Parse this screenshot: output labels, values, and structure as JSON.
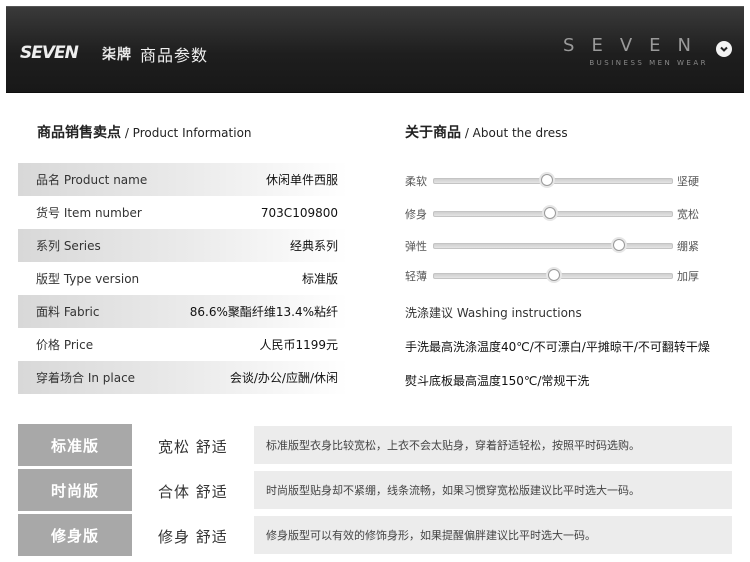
{
  "header": {
    "logo_text": "SEVEN",
    "logo_sub": "柒牌",
    "title": "商品参数",
    "brand_word": "SEVEN",
    "brand_tagline": "BUSINESS MEN WEAR",
    "icon": "chevron-down-icon"
  },
  "product_info": {
    "title_cn": "商品销售卖点",
    "title_en": "/ Product Information",
    "rows": [
      {
        "label": "品名 Product name",
        "value": "休闲单件西服"
      },
      {
        "label": "货号 Item number",
        "value": "703C109800"
      },
      {
        "label": "系列 Series",
        "value": "经典系列"
      },
      {
        "label": "版型 Type version",
        "value": "标准版"
      },
      {
        "label": "面料 Fabric",
        "value": "86.6%聚酯纤维13.4%粘纤"
      },
      {
        "label": "价格 Price",
        "value": "人民币1199元"
      },
      {
        "label": "穿着场合 In place",
        "value": "会谈/办公/应酬/休闲"
      }
    ]
  },
  "about": {
    "title_cn": "关于商品",
    "title_en": "/ About the dress",
    "sliders": [
      {
        "left": "柔软",
        "right": "坚硬",
        "level": 0.48
      },
      {
        "left": "修身",
        "right": "宽松",
        "level": 0.49
      },
      {
        "left": "弹性",
        "right": "绷紧",
        "level": 0.78
      },
      {
        "left": "轻薄",
        "right": "加厚",
        "level": 0.51
      }
    ],
    "washing_title": "洗涤建议  Washing instructions",
    "washing_lines": [
      "手洗最高洗涤温度40℃/不可漂白/平摊晾干/不可翻转干燥",
      "熨斗底板最高温度150℃/常规干洗"
    ]
  },
  "versions": [
    {
      "name": "标准版",
      "fit": "宽松 舒适",
      "desc": "标准版型衣身比较宽松，上衣不会太贴身，穿着舒适轻松，按照平时码选购。"
    },
    {
      "name": "时尚版",
      "fit": "合体 舒适",
      "desc": "时尚版型贴身却不紧绷，线条流畅，如果习惯穿宽松版建议比平时选大一码。"
    },
    {
      "name": "修身版",
      "fit": "修身 舒适",
      "desc": "修身版型可以有效的修饰身形，如果提醒偏胖建议比平时选大一码。"
    }
  ]
}
